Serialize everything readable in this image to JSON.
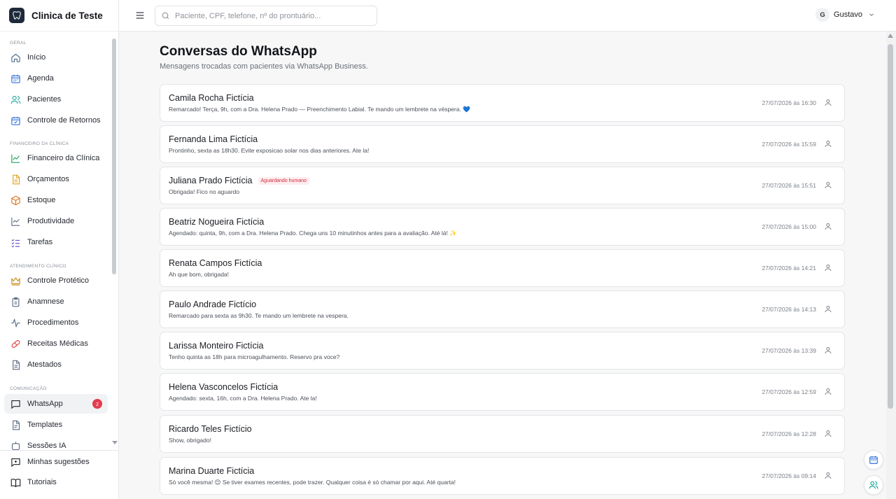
{
  "brand": {
    "name": "Clinica de Teste"
  },
  "search": {
    "placeholder": "Paciente, CPF, telefone, nº do prontuário..."
  },
  "user": {
    "initial": "G",
    "name": "Gustavo"
  },
  "colors": {
    "accent": "#e23b4f",
    "tag": "#d1293d",
    "sidebar_active": "#f1f2f4"
  },
  "sidebar": {
    "sections": {
      "geral": "GERAL",
      "financeiro": "FINANCEIRO DA CLÍNICA",
      "atendimento": "ATENDIMENTO CLÍNICO",
      "comunicacao": "COMUNICAÇÃO"
    },
    "items": [
      {
        "label": "Início",
        "icon": "home-icon"
      },
      {
        "label": "Agenda",
        "icon": "calendar-icon"
      },
      {
        "label": "Pacientes",
        "icon": "users-icon"
      },
      {
        "label": "Controle de Retornos",
        "icon": "calendar-check-icon"
      },
      {
        "label": "Financeiro da Clínica",
        "icon": "chart-line-icon"
      },
      {
        "label": "Orçamentos",
        "icon": "document-icon"
      },
      {
        "label": "Estoque",
        "icon": "box-icon"
      },
      {
        "label": "Produtividade",
        "icon": "trend-icon"
      },
      {
        "label": "Tarefas",
        "icon": "checklist-icon"
      },
      {
        "label": "Controle Protético",
        "icon": "crown-icon"
      },
      {
        "label": "Anamnese",
        "icon": "clipboard-icon"
      },
      {
        "label": "Procedimentos",
        "icon": "activity-icon"
      },
      {
        "label": "Receitas Médicas",
        "icon": "pill-icon"
      },
      {
        "label": "Atestados",
        "icon": "file-icon"
      },
      {
        "label": "WhatsApp",
        "icon": "chat-icon",
        "badge": "2"
      },
      {
        "label": "Templates",
        "icon": "template-icon"
      },
      {
        "label": "Sessões IA",
        "icon": "ai-icon"
      }
    ],
    "bottom": [
      {
        "label": "Minhas sugestões",
        "icon": "suggestion-icon"
      },
      {
        "label": "Tutoriais",
        "icon": "book-icon"
      }
    ]
  },
  "page": {
    "title": "Conversas do WhatsApp",
    "subtitle": "Mensagens trocadas com pacientes via WhatsApp Business."
  },
  "conversations": [
    {
      "name": "Camila Rocha Fictícia",
      "message": "Remarcado! Terça, 9h, com a Dra. Helena Prado — Preenchimento Labial. Te mando um lembrete na véspera. 💙",
      "time": "27/07/2026 às 16:30",
      "tag": ""
    },
    {
      "name": "Fernanda Lima Fictícia",
      "message": "Prontinho, sexta as 18h30. Evite exposicao solar nos dias anteriores. Ate la!",
      "time": "27/07/2026 às 15:59",
      "tag": ""
    },
    {
      "name": "Juliana Prado Fictícia",
      "message": "Obrigada! Fico no aguardo",
      "time": "27/07/2026 às 15:51",
      "tag": "Aguardando humano"
    },
    {
      "name": "Beatriz Nogueira Fictícia",
      "message": "Agendado: quinta, 9h, com a Dra. Helena Prado. Chega uns 10 minutinhos antes para a avaliação. Até lá! ✨",
      "time": "27/07/2026 às 15:00",
      "tag": ""
    },
    {
      "name": "Renata Campos Fictícia",
      "message": "Ah que bom, obrigada!",
      "time": "27/07/2026 às 14:21",
      "tag": ""
    },
    {
      "name": "Paulo Andrade Fictício",
      "message": "Remarcado para sexta as 9h30. Te mando um lembrete na vespera.",
      "time": "27/07/2026 às 14:13",
      "tag": ""
    },
    {
      "name": "Larissa Monteiro Fictícia",
      "message": "Tenho quinta as 18h para microagulhamento. Reservo pra voce?",
      "time": "27/07/2026 às 13:39",
      "tag": ""
    },
    {
      "name": "Helena Vasconcelos Fictícia",
      "message": "Agendado: sexta, 16h, com a Dra. Helena Prado. Ate la!",
      "time": "27/07/2026 às 12:59",
      "tag": ""
    },
    {
      "name": "Ricardo Teles Fictício",
      "message": "Show, obrigado!",
      "time": "27/07/2026 às 12:28",
      "tag": ""
    },
    {
      "name": "Marina Duarte Fictícia",
      "message": "Só você mesma! 😊 Se tiver exames recentes, pode trazer. Qualquer coisa é só chamar por aqui. Até quarta!",
      "time": "27/07/2026 às 09:14",
      "tag": ""
    }
  ]
}
